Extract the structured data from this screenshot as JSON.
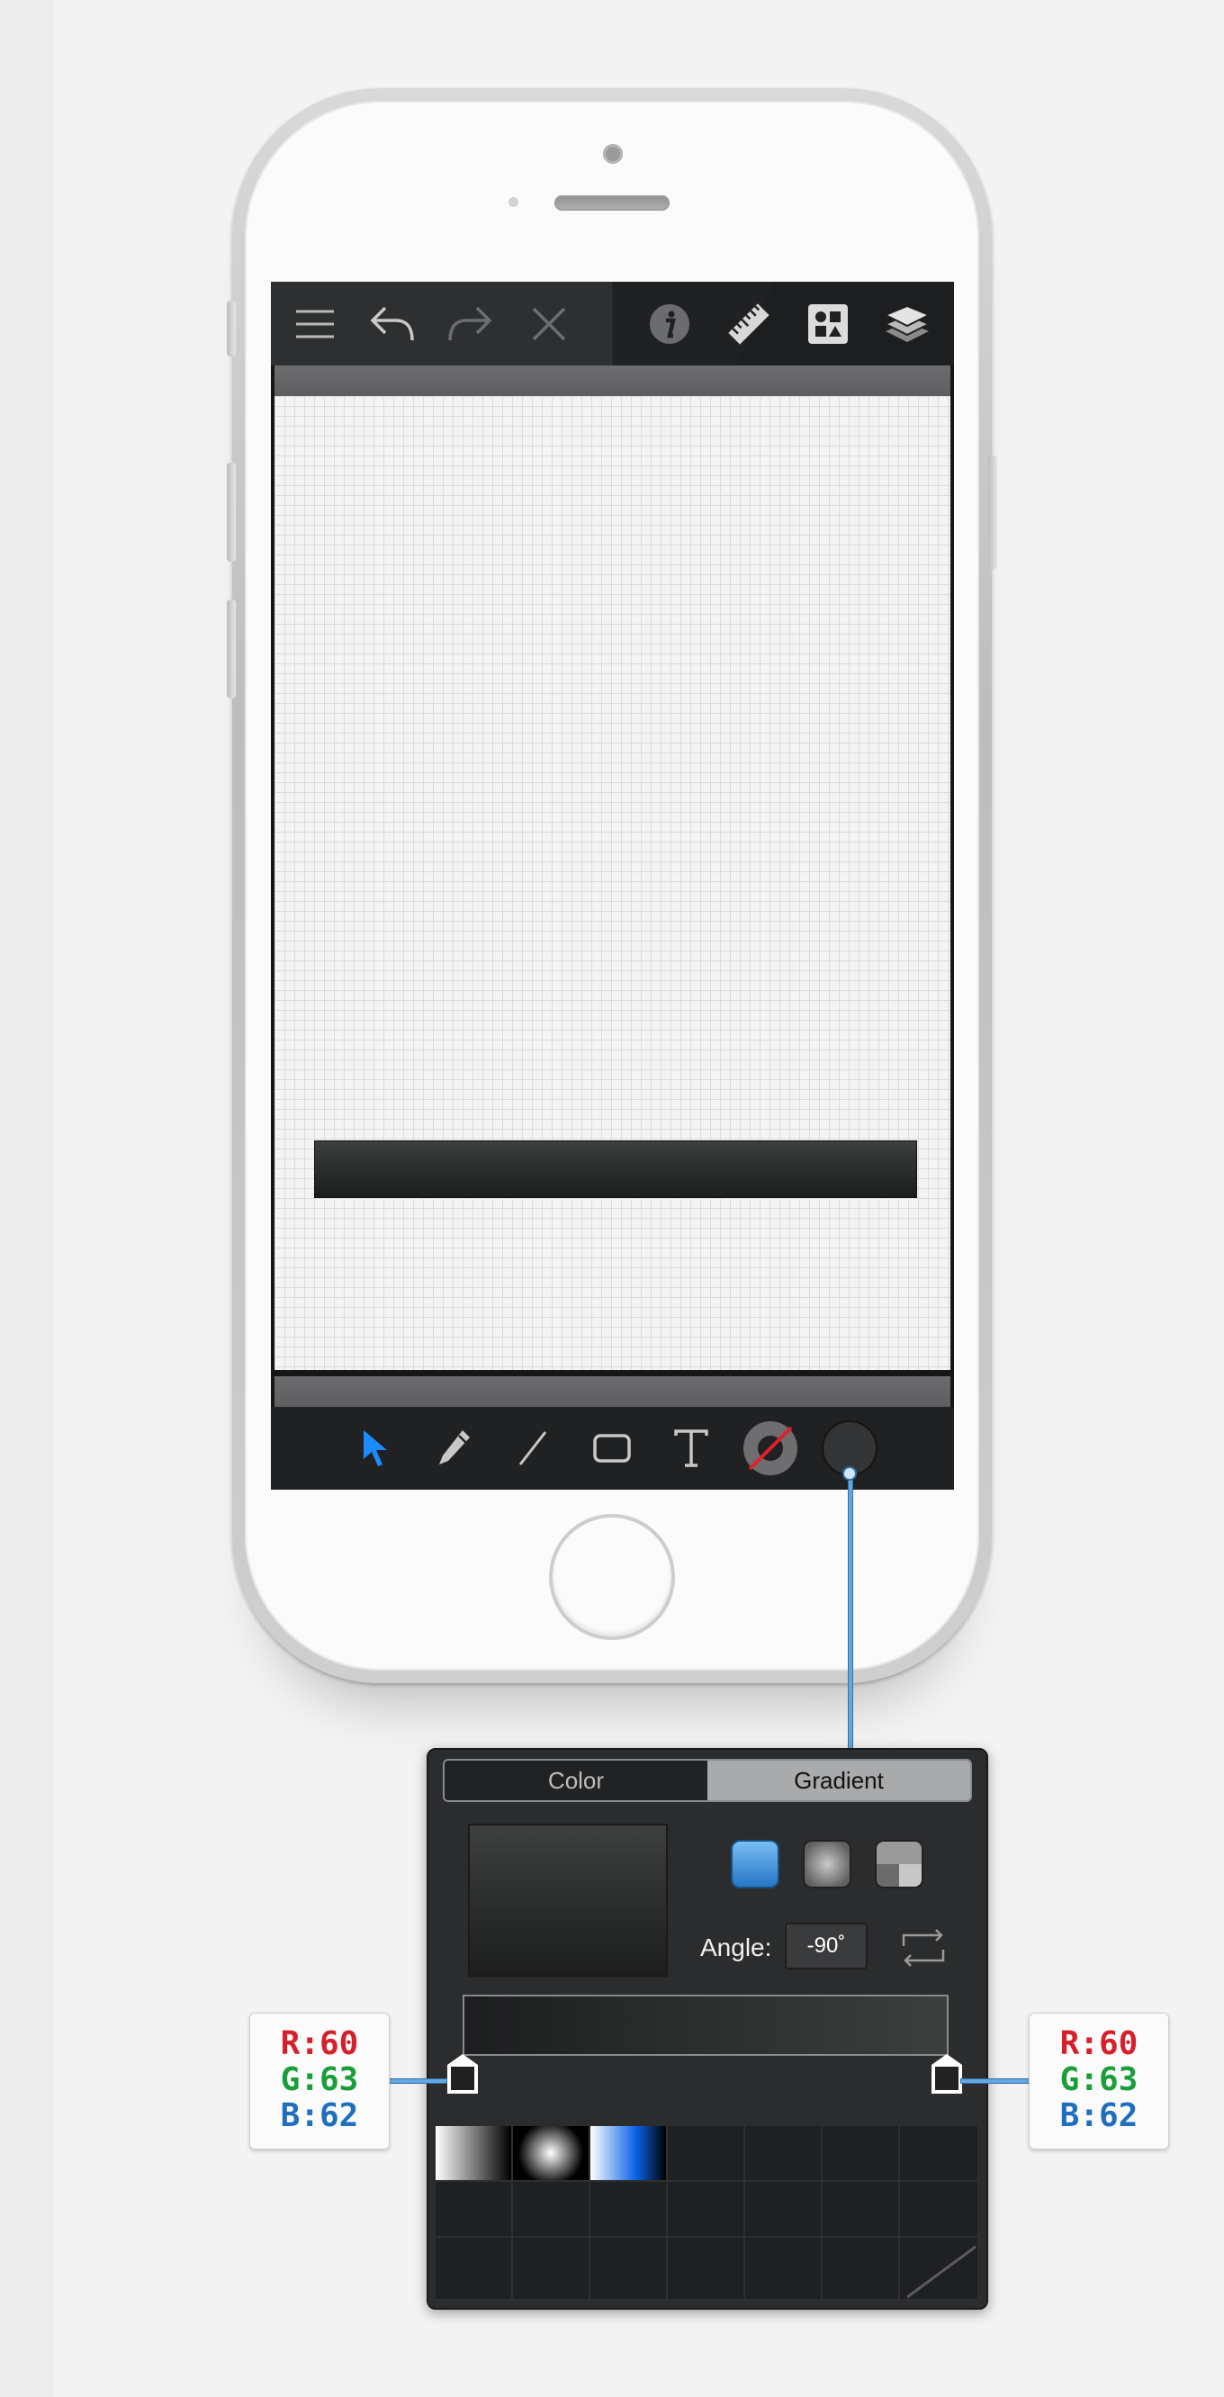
{
  "toolbar_top": {
    "icons": [
      "menu-icon",
      "undo-icon",
      "redo-icon",
      "close-icon",
      "info-icon",
      "ruler-icon",
      "shapes-icon",
      "layers-icon"
    ]
  },
  "toolbar_bottom": {
    "icons": [
      "select-arrow-icon",
      "pen-icon",
      "line-icon",
      "rectangle-icon",
      "text-icon",
      "stroke-color-icon",
      "fill-color-icon"
    ],
    "accent": "#1a8cff"
  },
  "fill_panel": {
    "tabs": [
      {
        "label": "Color",
        "selected": false
      },
      {
        "label": "Gradient",
        "selected": true
      }
    ],
    "gradient_types": [
      "linear-gradient-icon",
      "radial-gradient-icon",
      "angle-gradient-icon"
    ],
    "selected_type": "linear",
    "angle_label": "Angle:",
    "angle_value": "-90˚",
    "stops": [
      {
        "color": "#3c3f3e",
        "position": 0
      },
      {
        "color": "#1d1e1f",
        "position": 1
      }
    ],
    "presets": [
      "white-black linear",
      "white-black radial",
      "white-blue-black linear"
    ]
  },
  "callouts": {
    "left": {
      "r": "R:60",
      "g": "G:63",
      "b": "B:62"
    },
    "right": {
      "r": "R:60",
      "g": "G:63",
      "b": "B:62"
    }
  },
  "colors": {
    "highlight_blue": "#62a8e2",
    "panel_bg": "#2b2c2e",
    "shape_fill_top": "#3c3f3e",
    "shape_fill_bottom": "#1c1d1e"
  }
}
